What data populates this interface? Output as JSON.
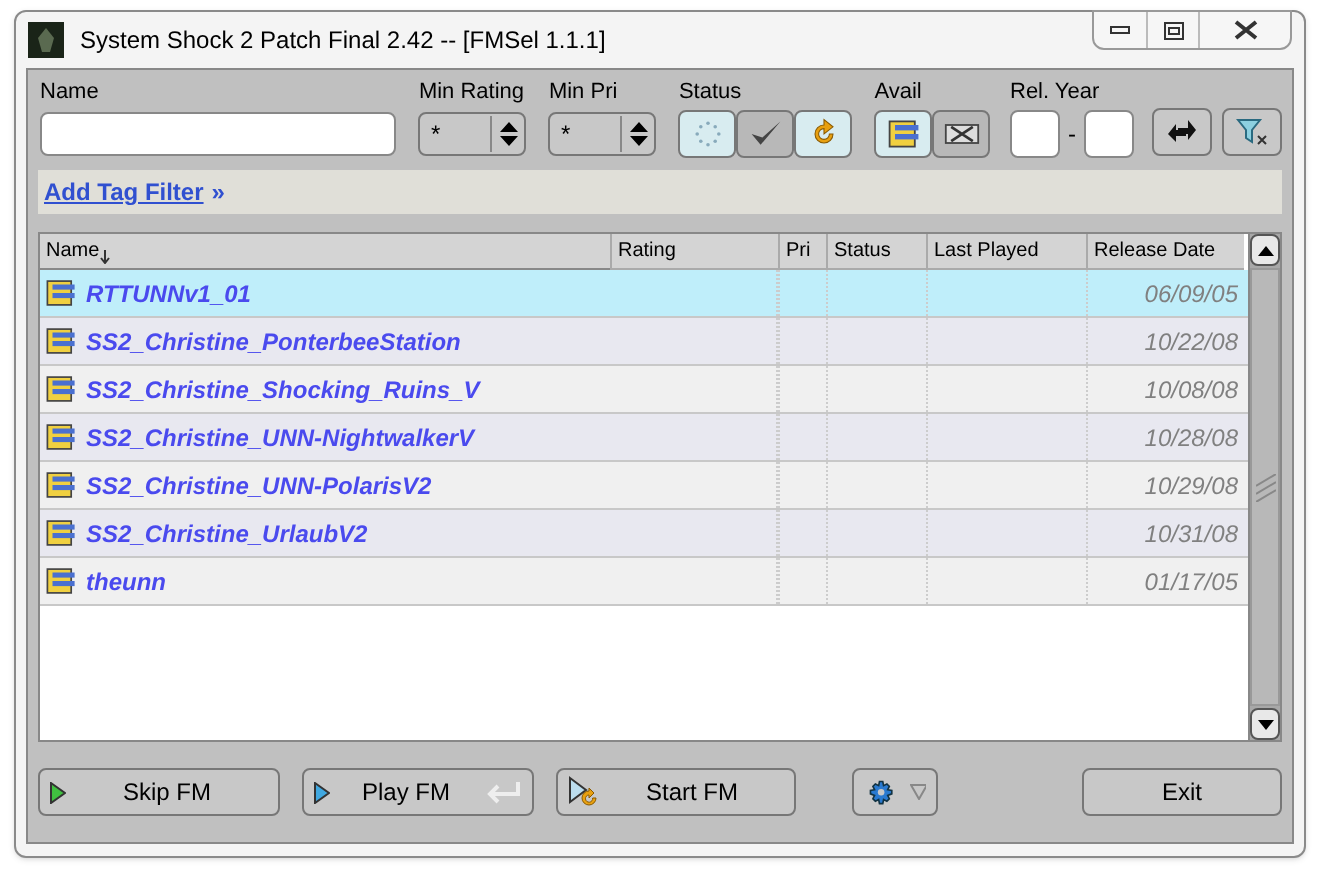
{
  "window": {
    "title": "System Shock 2 Patch Final 2.42 -- [FMSel 1.1.1]"
  },
  "filters": {
    "name": {
      "label": "Name"
    },
    "min_rating": {
      "label": "Min Rating",
      "value": "*"
    },
    "min_pri": {
      "label": "Min Pri",
      "value": "*"
    },
    "status": {
      "label": "Status",
      "toggles": [
        {
          "kind": "new",
          "selected": true
        },
        {
          "kind": "done",
          "selected": false
        },
        {
          "kind": "progress",
          "selected": true
        }
      ]
    },
    "avail": {
      "label": "Avail",
      "toggles": [
        {
          "kind": "installed",
          "selected": true
        },
        {
          "kind": "archived",
          "selected": false
        }
      ]
    },
    "rel_year": {
      "label": "Rel. Year",
      "separator": "-"
    }
  },
  "tag_filter": {
    "link": "Add Tag Filter",
    "arrow": "»"
  },
  "table": {
    "columns": [
      "Name",
      "Rating",
      "Pri",
      "Status",
      "Last Played",
      "Release Date"
    ],
    "rows": [
      {
        "name": "RTTUNNv1_01",
        "release_date": "06/09/05",
        "selected": true
      },
      {
        "name": "SS2_Christine_PonterbeeStation",
        "release_date": "10/22/08",
        "selected": false
      },
      {
        "name": "SS2_Christine_Shocking_Ruins_V",
        "release_date": "10/08/08",
        "selected": false
      },
      {
        "name": "SS2_Christine_UNN-NightwalkerV",
        "release_date": "10/28/08",
        "selected": false
      },
      {
        "name": "SS2_Christine_UNN-PolarisV2",
        "release_date": "10/29/08",
        "selected": false
      },
      {
        "name": "SS2_Christine_UrlaubV2",
        "release_date": "10/31/08",
        "selected": false
      },
      {
        "name": "theunn",
        "release_date": "01/17/05",
        "selected": false
      }
    ]
  },
  "buttons": [
    {
      "kind": "skip",
      "label": "Skip FM"
    },
    {
      "kind": "play",
      "label": "Play FM"
    },
    {
      "kind": "start",
      "label": "Start FM"
    },
    {
      "kind": "settings"
    },
    {
      "kind": "exit",
      "label": "Exit"
    }
  ]
}
